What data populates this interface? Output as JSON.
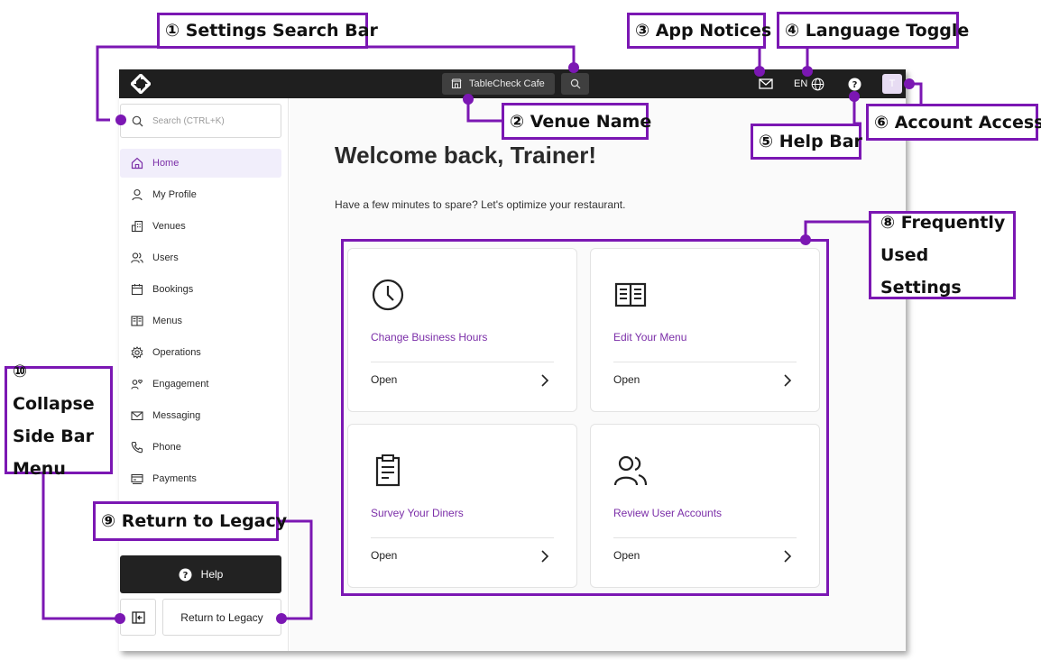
{
  "topbar": {
    "venue_name": "TableCheck Cafe",
    "language": "EN",
    "avatar_initial": "T"
  },
  "sidebar": {
    "search_placeholder": "Search (CTRL+K)",
    "items": [
      {
        "label": "Home",
        "icon": "home-icon",
        "active": true
      },
      {
        "label": "My Profile",
        "icon": "profile-icon"
      },
      {
        "label": "Venues",
        "icon": "building-icon"
      },
      {
        "label": "Users",
        "icon": "users-icon"
      },
      {
        "label": "Bookings",
        "icon": "calendar-icon"
      },
      {
        "label": "Menus",
        "icon": "menu-book-icon"
      },
      {
        "label": "Operations",
        "icon": "gear-icon"
      },
      {
        "label": "Engagement",
        "icon": "engagement-icon"
      },
      {
        "label": "Messaging",
        "icon": "mail-icon"
      },
      {
        "label": "Phone",
        "icon": "phone-icon"
      },
      {
        "label": "Payments",
        "icon": "payments-icon"
      }
    ],
    "help_label": "Help",
    "legacy_label": "Return to Legacy"
  },
  "main": {
    "welcome": "Welcome back, Trainer!",
    "subtitle": "Have a few minutes to spare? Let's optimize your restaurant.",
    "cards": [
      {
        "title": "Change Business Hours",
        "action": "Open",
        "icon": "clock-icon"
      },
      {
        "title": "Edit Your Menu",
        "action": "Open",
        "icon": "menu-book-icon"
      },
      {
        "title": "Survey Your Diners",
        "action": "Open",
        "icon": "clipboard-icon"
      },
      {
        "title": "Review User Accounts",
        "action": "Open",
        "icon": "users-icon"
      }
    ]
  },
  "annotations": {
    "a1": "① Settings Search Bar",
    "a2": "② Venue Name",
    "a3": "③ App Notices",
    "a4": "④ Language Toggle",
    "a5": "⑤ Help Bar",
    "a6": "⑥ Account Access",
    "a8_line1": "⑧ Frequently",
    "a8_line2": "Used Settings",
    "a9": "⑨ Return to Legacy",
    "a10_line1": "⑩ Collapse",
    "a10_line2": "Side Bar",
    "a10_line3": "Menu"
  },
  "colors": {
    "accent": "#7b2ea8",
    "annotation": "#7b17b3",
    "topbar": "#1f1f1f"
  }
}
